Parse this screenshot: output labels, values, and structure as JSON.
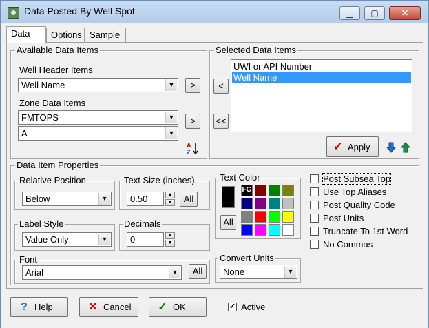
{
  "window": {
    "title": "Data Posted By Well Spot",
    "minimize": "▁",
    "maximize": "▢",
    "close": "✕"
  },
  "tabs": [
    {
      "label": "Data",
      "active": true
    },
    {
      "label": "Options",
      "active": false
    },
    {
      "label": "Sample",
      "active": false
    }
  ],
  "available": {
    "group_label": "Available Data Items",
    "well_header_label": "Well Header Items",
    "well_header_value": "Well Name",
    "zone_label": "Zone Data Items",
    "zone_value": "FMTOPS",
    "zone_sub_value": "A",
    "add_label": ">",
    "sort_icon": "sort-az-icon"
  },
  "selected": {
    "group_label": "Selected Data Items",
    "items": [
      "UWI or API Number",
      "Well Name"
    ],
    "selected_index": 1,
    "remove_label": "<",
    "remove_all_label": "<<",
    "apply_label": "Apply"
  },
  "properties": {
    "group_label": "Data Item Properties",
    "relative_position": {
      "label": "Relative Position",
      "value": "Below"
    },
    "text_size": {
      "label": "Text Size (inches)",
      "value": "0.50",
      "all_label": "All"
    },
    "label_style": {
      "label": "Label Style",
      "value": "Value Only"
    },
    "decimals": {
      "label": "Decimals",
      "value": "0"
    },
    "font": {
      "label": "Font",
      "value": "Arial",
      "all_label": "All"
    },
    "convert_units": {
      "label": "Convert Units",
      "value": "None"
    },
    "text_color": {
      "label": "Text Color",
      "current": "#000000",
      "fg_label": "FG",
      "all_label": "All",
      "palette": [
        "#000000",
        "#800000",
        "#008000",
        "#808000",
        "#000080",
        "#800080",
        "#008080",
        "#c0c0c0",
        "#808080",
        "#ff0000",
        "#00ff00",
        "#ffff00",
        "#0000ff",
        "#ff00ff",
        "#00ffff",
        "#ffffff"
      ]
    },
    "options": [
      {
        "label": "Post Subsea Top",
        "checked": false,
        "focused": true
      },
      {
        "label": "Use Top Aliases",
        "checked": false,
        "focused": false
      },
      {
        "label": "Post Quality Code",
        "checked": false,
        "focused": false
      },
      {
        "label": "Post Units",
        "checked": false,
        "focused": false
      },
      {
        "label": "Truncate To 1st Word",
        "checked": false,
        "focused": false
      },
      {
        "label": "No Commas",
        "checked": false,
        "focused": false
      }
    ]
  },
  "footer": {
    "help_label": "Help",
    "cancel_label": "Cancel",
    "ok_label": "OK",
    "active_label": "Active",
    "active_checked": true,
    "check_mark": "✓"
  },
  "colors": {
    "accent_selection": "#3399ff",
    "apply_check": "#cc0000",
    "ok_check": "#008000",
    "arrow_blue": "#1a6fd0"
  }
}
